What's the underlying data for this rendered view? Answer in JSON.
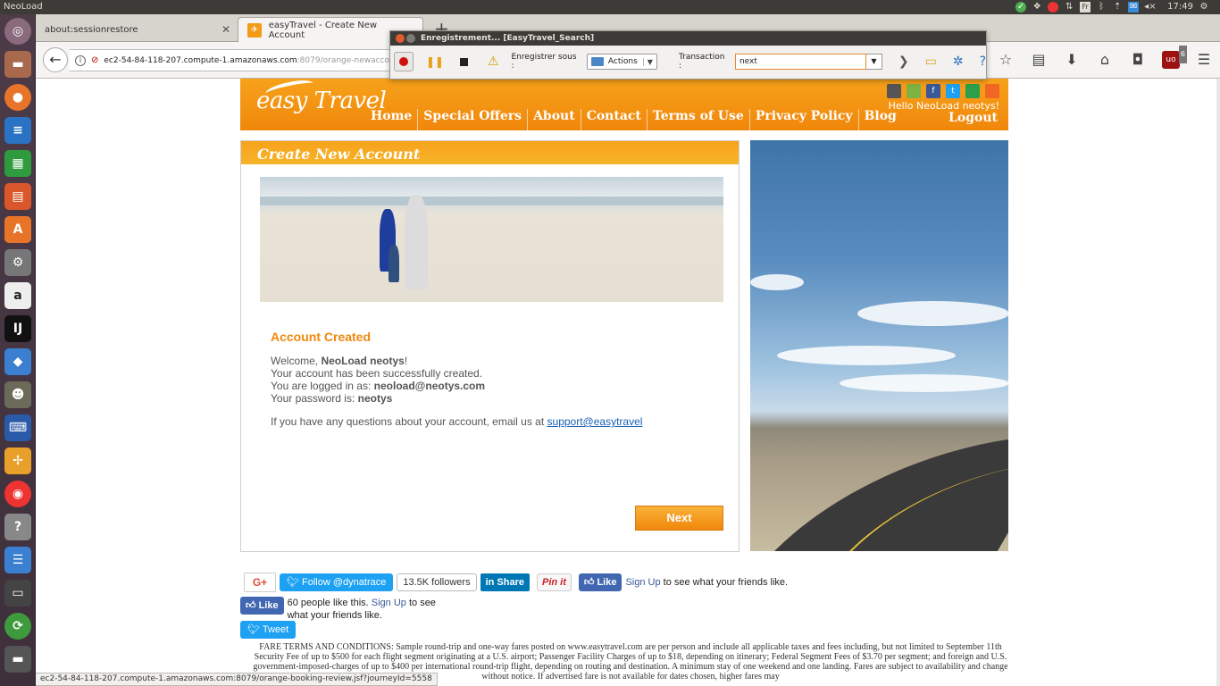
{
  "os": {
    "app_name": "NeoLoad",
    "tray_icons": [
      "check-icon",
      "dropbox-icon",
      "chrome-icon",
      "network-transfer-icon",
      "keyboard-layout-icon",
      "bluetooth-icon",
      "mail-icon",
      "wifi-icon",
      "volume-icon"
    ],
    "keyboard_layout": "Fr",
    "clock": "17:49",
    "launcher_icons": [
      "ubuntu-dash-icon",
      "files-icon",
      "firefox-icon",
      "writer-icon",
      "calc-icon",
      "impress-icon",
      "software-center-icon",
      "settings-icon",
      "amazon-icon",
      "intellij-icon",
      "box-icon",
      "gimp-icon",
      "remote-desktop-icon",
      "pinwheel-icon",
      "chrome-icon",
      "help-icon",
      "network-icon",
      "terminal-icon",
      "neoload-icon",
      "drive-icon",
      "trash-icon"
    ]
  },
  "browser": {
    "tabs": [
      {
        "title": "about:sessionrestore",
        "active": false
      },
      {
        "title": "easyTravel - Create New Account",
        "active": true
      }
    ],
    "url_host": "ec2-54-84-118-207.compute-1.amazonaws.com",
    "url_rest": ":8079/orange-newaccount-re",
    "status_url": "ec2-54-84-118-207.compute-1.amazonaws.com:8079/orange-booking-review.jsf?journeyId=5558",
    "ublock_count": "6"
  },
  "neoload": {
    "title": "Enregistrement... [EasyTravel_Search]",
    "record_under_label": "Enregistrer sous :",
    "record_under_value": "Actions",
    "transaction_label": "Transaction :",
    "transaction_value": "next"
  },
  "site": {
    "logo": "easy Travel",
    "nav": [
      "Home",
      "Special Offers",
      "About",
      "Contact",
      "Terms of Use",
      "Privacy Policy",
      "Blog"
    ],
    "hello": "Hello NeoLoad neotys!",
    "logout": "Logout",
    "panel_title": "Create New Account",
    "account": {
      "heading": "Account Created",
      "welcome_prefix": "Welcome, ",
      "user_name": "NeoLoad neotys",
      "welcome_suffix": "!",
      "created_msg": "Your account has been successfully created.",
      "logged_prefix": "You are logged in as: ",
      "email": "neoload@neotys.com",
      "password_prefix": "Your password is: ",
      "password": "neotys",
      "help_prefix": "If you have any questions about your account, email us at ",
      "support_link": "support@easytravel"
    },
    "next_button": "Next",
    "social": {
      "gplus": "G+",
      "follow": "Follow @dynatrace",
      "followers": "13.5K followers",
      "share": "Share",
      "pinit": "Pin it",
      "like": "Like",
      "signup": "Sign Up",
      "friends_text": " to see what your friends like.",
      "like_count_text": "60 people like this.",
      "friends_text2": " to see what your friends like.",
      "tweet": "Tweet"
    },
    "fare_terms": "FARE TERMS AND CONDITIONS: Sample round-trip and one-way fares posted on www.easytravel.com are per person and include all applicable taxes and fees including, but not limited to September 11th Security Fee of up to $500 for each flight segment originating at a U.S. airport; Passenger Facility Charges of up to $18, depending on itinerary; Federal Segment Fees of $3.70 per segment; and foreign and U.S. government-imposed-charges of up to $400 per international round-trip flight, depending on routing and destination. A minimum stay of one weekend and one landing. Fares are subject to availability and change without notice. If advertised fare is not available for dates chosen, higher fares may"
  }
}
